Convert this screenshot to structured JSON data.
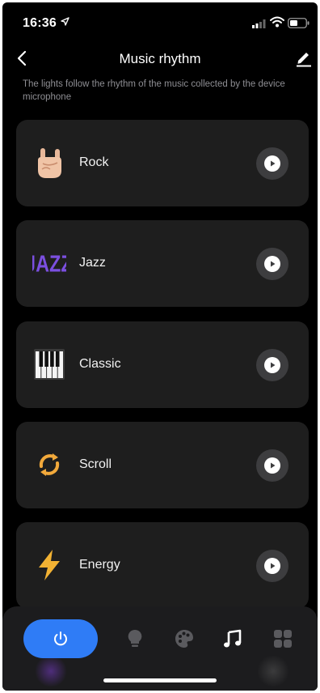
{
  "status_bar": {
    "time": "16:36"
  },
  "header": {
    "title": "Music rhythm"
  },
  "description": "The lights follow the rhythm of the music collected by the device microphone",
  "modes": [
    {
      "label": "Rock",
      "icon": "rock-hand-icon"
    },
    {
      "label": "Jazz",
      "icon": "jazz-icon",
      "icon_text": "JAZZ"
    },
    {
      "label": "Classic",
      "icon": "piano-icon"
    },
    {
      "label": "Scroll",
      "icon": "scroll-arrows-icon"
    },
    {
      "label": "Energy",
      "icon": "lightning-icon"
    }
  ],
  "bottom_nav": {
    "items": [
      "power",
      "bulb",
      "palette",
      "music",
      "grid"
    ],
    "active": "music"
  },
  "colors": {
    "accent": "#2f7cf6",
    "jazz": "#7b4fe0",
    "scroll": "#f2a93b",
    "energy": "#f2b233",
    "card": "#1e1e1e"
  }
}
